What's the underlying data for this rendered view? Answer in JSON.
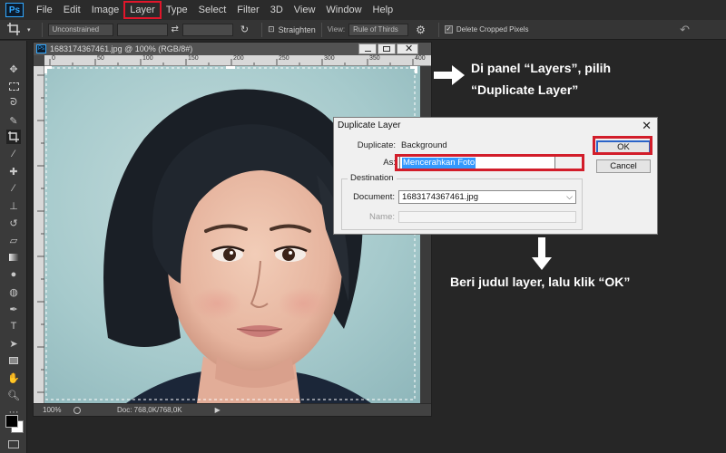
{
  "app": {
    "logo": "Ps"
  },
  "menu": {
    "items": [
      "File",
      "Edit",
      "Image",
      "Layer",
      "Type",
      "Select",
      "Filter",
      "3D",
      "View",
      "Window",
      "Help"
    ],
    "highlighted": "Layer",
    "highlight_color": "#e0162b"
  },
  "options_bar": {
    "ratio_value": "Unconstrained",
    "straighten_label": "Straighten",
    "view_label": "View:",
    "view_value": "Rule of Thirds",
    "delete_cropped_label": "Delete Cropped Pixels"
  },
  "document": {
    "title": "1683174367461.jpg @ 100% (RGB/8#)",
    "ruler_ticks": [
      "0",
      "50",
      "100",
      "150",
      "200",
      "250",
      "300",
      "350",
      "400"
    ],
    "zoom": "100%",
    "doc_size": "Doc: 768,0K/768,0K"
  },
  "dialog": {
    "title": "Duplicate Layer",
    "duplicate_label": "Duplicate:",
    "duplicate_value": "Background",
    "as_label": "As:",
    "as_value": "Mencerahkan Foto",
    "destination_legend": "Destination",
    "document_label": "Document:",
    "document_value": "1683174367461.jpg",
    "name_label": "Name:",
    "ok_label": "OK",
    "cancel_label": "Cancel"
  },
  "annotations": {
    "top_line1": "Di panel “Layers”, pilih",
    "top_line2": "“Duplicate Layer”",
    "bottom": "Beri judul layer, lalu klik “OK”"
  },
  "colors": {
    "accent_red": "#d21d2a",
    "foreground_swatch": "#000000",
    "background_swatch": "#ffffff"
  }
}
